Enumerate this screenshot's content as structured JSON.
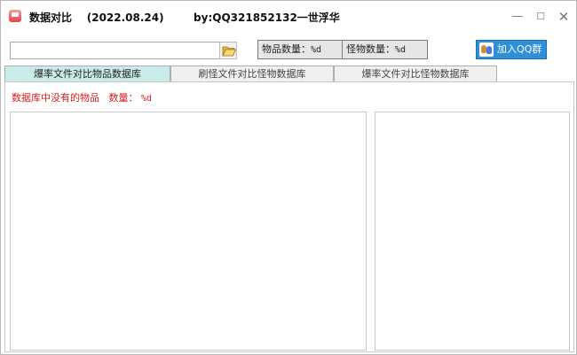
{
  "window": {
    "title": "数据对比",
    "date": "(2022.08.24)",
    "author": "by:QQ321852132一世浮华",
    "controls": {
      "minimize": "—",
      "maximize": "☐",
      "close": "✕"
    }
  },
  "toolbar": {
    "path_value": "",
    "item_count": {
      "label": "物品数量：",
      "value": "%d"
    },
    "monster_count": {
      "label": "怪物数量：",
      "value": "%d"
    },
    "qq_button_label": "加入QQ群"
  },
  "tabs": [
    {
      "label": "爆率文件对比物品数据库",
      "active": true
    },
    {
      "label": "刷怪文件对比怪物数据库",
      "active": false
    },
    {
      "label": "爆率文件对比怪物数据库",
      "active": false
    }
  ],
  "panel": {
    "missing_label": "数据库中没有的物品",
    "count_label": "数量：",
    "count_value": "%d"
  },
  "colors": {
    "active_tab": "#c9ece8",
    "warning_text": "#d81e1e",
    "qq_button": "#2f8fd8"
  },
  "icons": [
    "app-icon",
    "folder-open-icon",
    "qq-group-icon"
  ]
}
